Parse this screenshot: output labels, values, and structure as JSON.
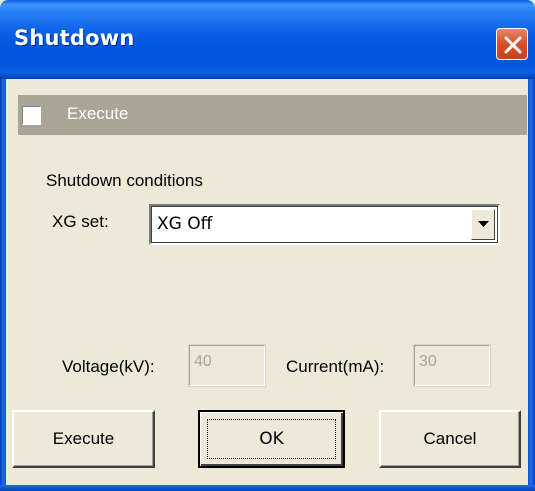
{
  "window": {
    "title": "Shutdown",
    "close_icon": "close-icon"
  },
  "execute_section": {
    "checkbox_checked": false,
    "label": "Execute"
  },
  "conditions": {
    "heading": "Shutdown conditions",
    "xg_set_label": "XG set:",
    "xg_set_value": "XG Off"
  },
  "parameters": {
    "voltage_label": "Voltage(kV):",
    "voltage_value": "40",
    "current_label": "Current(mA):",
    "current_value": "30"
  },
  "buttons": {
    "execute": "Execute",
    "ok": "OK",
    "cancel": "Cancel"
  },
  "colors": {
    "titlebar": "#0055dc",
    "close_button": "#d9532f",
    "dialog_face": "#ece9d8",
    "execute_strip": "#a9a596"
  }
}
